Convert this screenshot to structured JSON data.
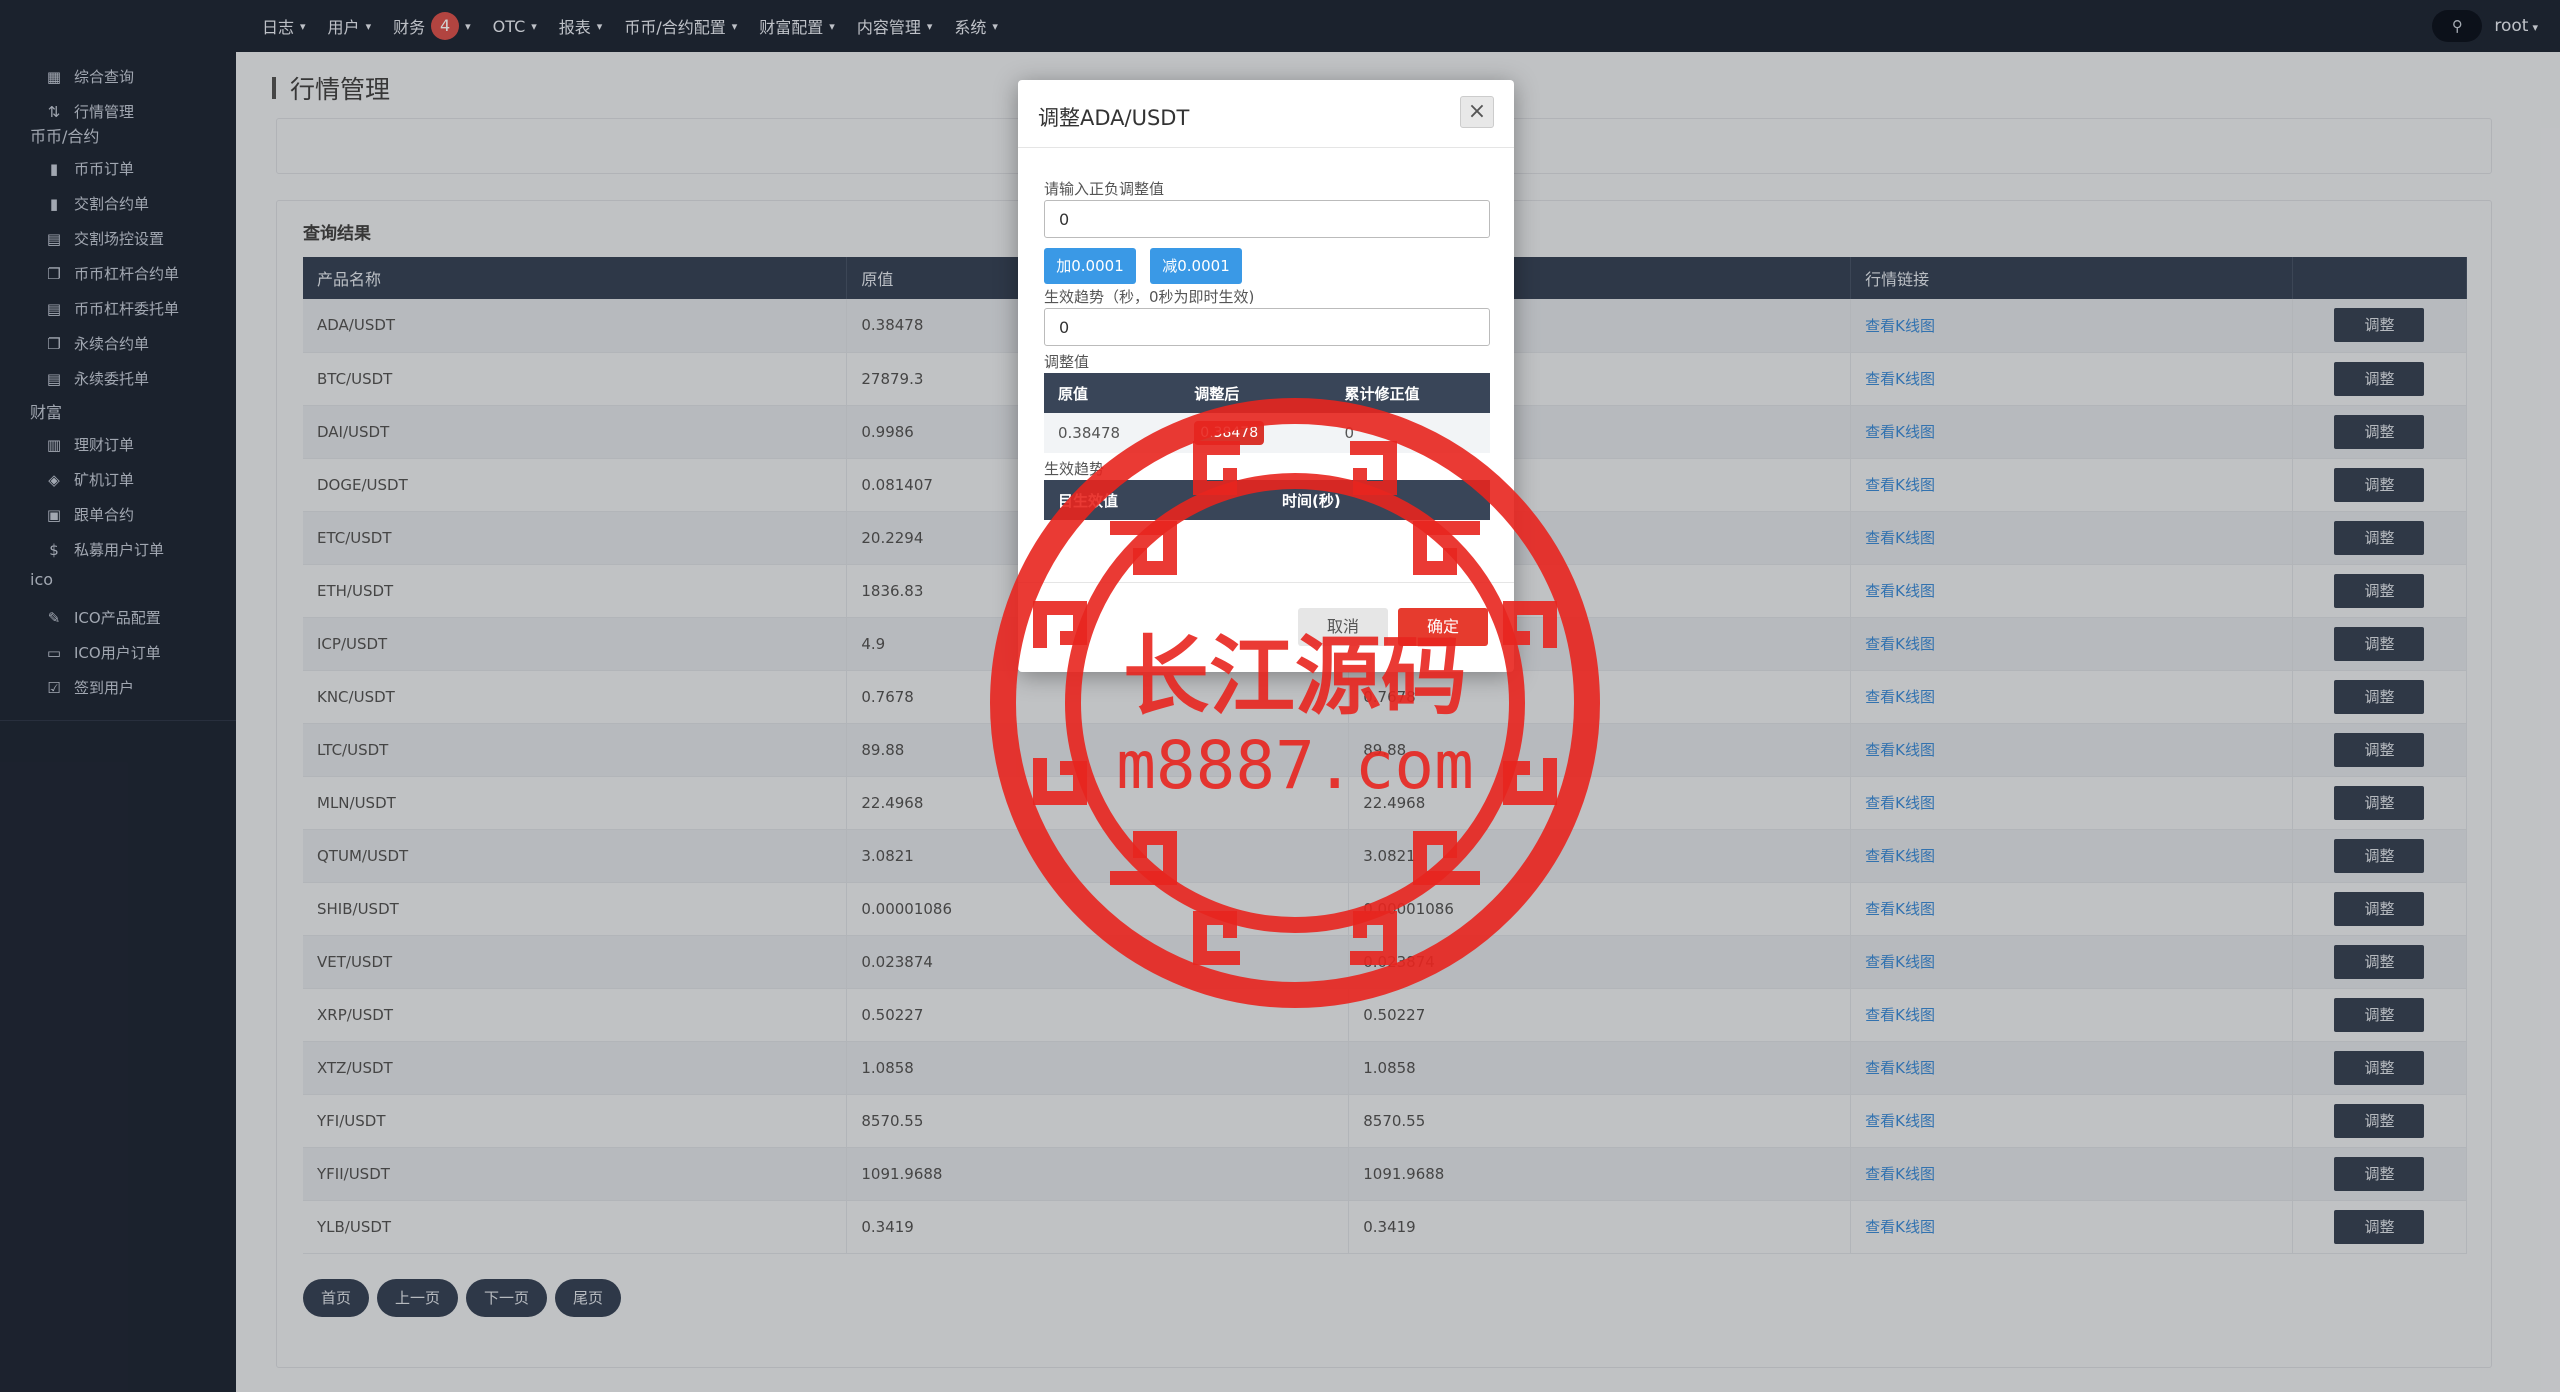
{
  "topnav": {
    "items": [
      {
        "label": "日志"
      },
      {
        "label": "用户"
      },
      {
        "label": "财务",
        "badge": "4"
      },
      {
        "label": "OTC"
      },
      {
        "label": "报表"
      },
      {
        "label": "币币/合约配置"
      },
      {
        "label": "财富配置"
      },
      {
        "label": "内容管理"
      },
      {
        "label": "系统"
      }
    ],
    "caret": "▾",
    "user": "root",
    "user_icon": "⚲"
  },
  "sidebar": {
    "top_items": [
      {
        "label": "综合查询",
        "icon": "grid-icon"
      },
      {
        "label": "行情管理",
        "icon": "sort-icon"
      }
    ],
    "groups": [
      {
        "label": "币币/合约",
        "items": [
          {
            "label": "币币订单",
            "icon": "bookmark-icon"
          },
          {
            "label": "交割合约单",
            "icon": "bookmark-icon"
          },
          {
            "label": "交割场控设置",
            "icon": "doc-icon"
          },
          {
            "label": "币币杠杆合约单",
            "icon": "copy-icon"
          },
          {
            "label": "币币杠杆委托单",
            "icon": "doc-gear-icon"
          },
          {
            "label": "永续合约单",
            "icon": "copy-icon"
          },
          {
            "label": "永续委托单",
            "icon": "doc-gear-icon"
          }
        ]
      },
      {
        "label": "财富",
        "items": [
          {
            "label": "理财订单",
            "icon": "server-icon"
          },
          {
            "label": "矿机订单",
            "icon": "gem-icon"
          },
          {
            "label": "跟单合约",
            "icon": "calendar-icon"
          },
          {
            "label": "私募用户订单",
            "icon": "dollar-icon"
          }
        ]
      },
      {
        "label": "ico",
        "items": [
          {
            "label": "ICO产品配置",
            "icon": "edit-icon"
          },
          {
            "label": "ICO用户订单",
            "icon": "message-icon"
          },
          {
            "label": "签到用户",
            "icon": "check-square-icon"
          }
        ]
      }
    ]
  },
  "page": {
    "title": "行情管理",
    "panel_title": "查询结果"
  },
  "table": {
    "headers": [
      "产品名称",
      "原值",
      "",
      "行情链接",
      ""
    ],
    "link_label": "查看K线图",
    "action_label": "调整",
    "rows": [
      {
        "name": "ADA/USDT",
        "orig": "0.38478",
        "now": ""
      },
      {
        "name": "BTC/USDT",
        "orig": "27879.3",
        "now": ""
      },
      {
        "name": "DAI/USDT",
        "orig": "0.9986",
        "now": ""
      },
      {
        "name": "DOGE/USDT",
        "orig": "0.081407",
        "now": ""
      },
      {
        "name": "ETC/USDT",
        "orig": "20.2294",
        "now": ""
      },
      {
        "name": "ETH/USDT",
        "orig": "1836.83",
        "now": ""
      },
      {
        "name": "ICP/USDT",
        "orig": "4.9",
        "now": ""
      },
      {
        "name": "KNC/USDT",
        "orig": "0.7678",
        "now": "0.7678"
      },
      {
        "name": "LTC/USDT",
        "orig": "89.88",
        "now": "89.88"
      },
      {
        "name": "MLN/USDT",
        "orig": "22.4968",
        "now": "22.4968"
      },
      {
        "name": "QTUM/USDT",
        "orig": "3.0821",
        "now": "3.0821"
      },
      {
        "name": "SHIB/USDT",
        "orig": "0.00001086",
        "now": "0.00001086"
      },
      {
        "name": "VET/USDT",
        "orig": "0.023874",
        "now": "0.023874"
      },
      {
        "name": "XRP/USDT",
        "orig": "0.50227",
        "now": "0.50227"
      },
      {
        "name": "XTZ/USDT",
        "orig": "1.0858",
        "now": "1.0858"
      },
      {
        "name": "YFI/USDT",
        "orig": "8570.55",
        "now": "8570.55"
      },
      {
        "name": "YFII/USDT",
        "orig": "1091.9688",
        "now": "1091.9688"
      },
      {
        "name": "YLB/USDT",
        "orig": "0.3419",
        "now": "0.3419"
      }
    ]
  },
  "pager": {
    "first": "首页",
    "prev": "上一页",
    "next": "下一页",
    "last": "尾页"
  },
  "modal": {
    "title": "调整ADA/USDT",
    "close_symbol": "×",
    "label_adjust": "请输入正负调整值",
    "adjust_value": "0",
    "btn_plus": "加0.0001",
    "btn_minus": "减0.0001",
    "label_trend": "生效趋势（秒，0秒为即时生效)",
    "trend_value": "0",
    "label_adjusted": "调整值",
    "t1_headers": [
      "原值",
      "调整后",
      "累计修正值"
    ],
    "t1_values": [
      "0.38478",
      "0.38478",
      "0"
    ],
    "label_effect": "生效趋势",
    "t2_headers": [
      "目生效值",
      "时间(秒)"
    ],
    "cancel": "取消",
    "ok": "确定"
  },
  "watermark": {
    "title": "长江源码",
    "url": "m8887.com",
    "color": "#e8251f"
  }
}
